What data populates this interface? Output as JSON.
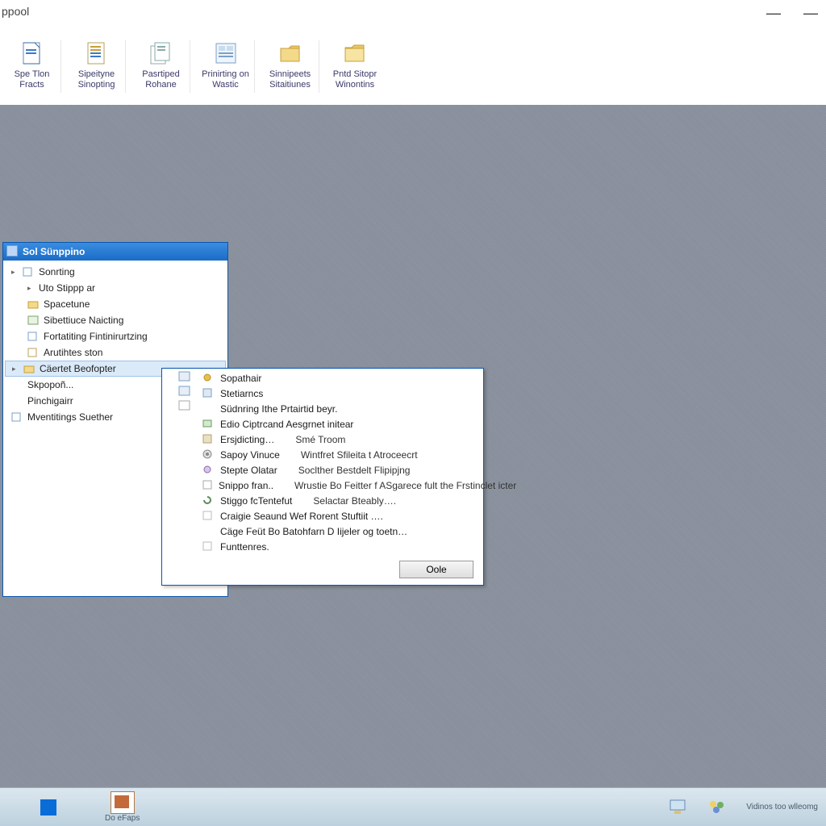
{
  "app": {
    "title": "ppool"
  },
  "window_controls": {
    "minimize": "—",
    "maximize": "—"
  },
  "toolbar": {
    "items": [
      {
        "line1": "Spe Tlon",
        "line2": "Fracts"
      },
      {
        "line1": "Sipeityne",
        "line2": "Sinopting"
      },
      {
        "line1": "Pasrtiped",
        "line2": "Rohane"
      },
      {
        "line1": "Prinirting on",
        "line2": "Wastic"
      },
      {
        "line1": "Sinnipeets",
        "line2": "Sitaitiunes"
      },
      {
        "line1": "Pntd Sitopr",
        "line2": "Winontins"
      }
    ]
  },
  "panel": {
    "title": "Sol Sünppino",
    "tree": [
      {
        "label": "Sonrting",
        "level": 1,
        "expander": "▸"
      },
      {
        "label": "Uto Stippp ar",
        "level": 2,
        "expander": "▸"
      },
      {
        "label": "Spacetune",
        "level": 2,
        "expander": ""
      },
      {
        "label": "Sibettiuce Naicting",
        "level": 2,
        "expander": ""
      },
      {
        "label": "Fortatiting Fintinirurtzing",
        "level": 2,
        "expander": ""
      },
      {
        "label": "Arutihtes ston",
        "level": 2,
        "expander": ""
      },
      {
        "label": "Cäertet Beofopter",
        "level": 1,
        "expander": "▸",
        "selected": true
      },
      {
        "label": "Skpopoñ...",
        "level": 2,
        "expander": ""
      },
      {
        "label": "Pinchigairr",
        "level": 2,
        "expander": ""
      },
      {
        "label": "Mventitings Suether",
        "level": 1,
        "expander": ""
      }
    ]
  },
  "context_menu": {
    "items": [
      {
        "col1": "Sopathair",
        "col2": ""
      },
      {
        "col1": "Stetiarncs",
        "col2": ""
      },
      {
        "col1": "Südnring Ithe Prtairtid beyr.",
        "col2": ""
      },
      {
        "col1": "Edio Ciptrcand Aesgrnet initear",
        "col2": ""
      },
      {
        "col1": "Ersjdicting…",
        "col2": "Smé Troom"
      },
      {
        "col1": "Sapoy Vinuce",
        "col2": "Wintfret Sfileita t Atroceecrt"
      },
      {
        "col1": "Stepte Olatar",
        "col2": "Soclther Bestdelt Flipipjng"
      },
      {
        "col1": "Snippo fran..",
        "col2": "Wrustie Bo Feitter f ASgarece fult the Frstinclet icter"
      },
      {
        "col1": "Stiggo fcTentefut",
        "col2": "Selactar Bteably…."
      },
      {
        "col1": "Craigie Seaund Wef Rorent Stuftiit ….",
        "col2": ""
      },
      {
        "col1": "Cäge Feüt Bo Batohfarn D Iijeler og toetn…",
        "col2": ""
      },
      {
        "col1": "Funttenres.",
        "col2": ""
      }
    ],
    "button": "Oole"
  },
  "taskbar": {
    "item_label": "Do eFaps",
    "tray_label": "Vidinos too wlleomg"
  }
}
